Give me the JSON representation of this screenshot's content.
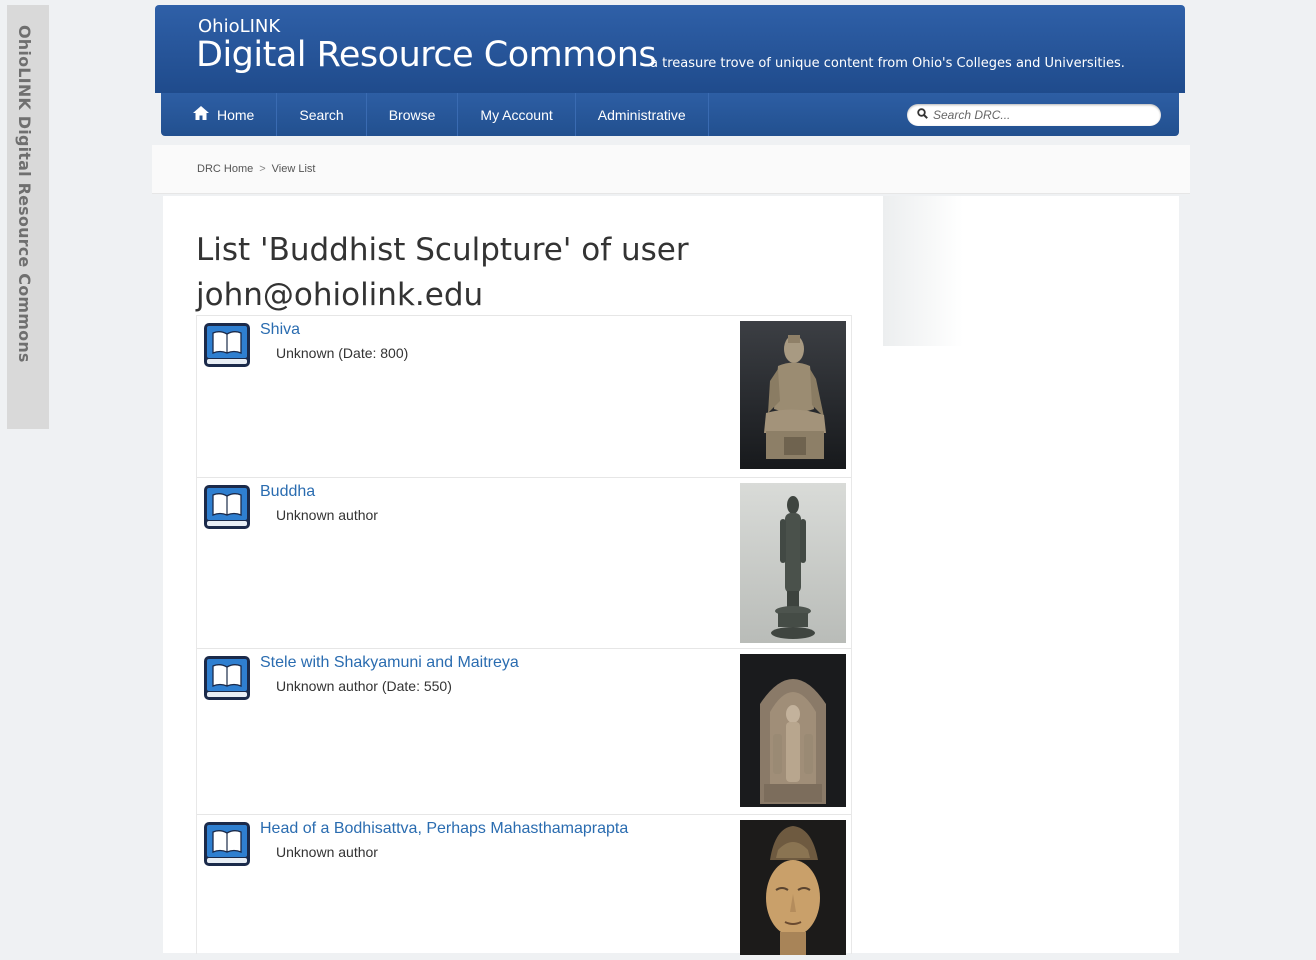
{
  "side_tab": "OhioLINK Digital Resource Commons",
  "header": {
    "brand_small": "OhioLINK",
    "brand_big": "Digital Resource Commons",
    "tagline": "a treasure trove of unique content from Ohio's Colleges and Universities."
  },
  "nav": {
    "items": [
      {
        "label": "Home",
        "icon": "home-icon"
      },
      {
        "label": "Search"
      },
      {
        "label": "Browse"
      },
      {
        "label": "My Account"
      },
      {
        "label": "Administrative"
      }
    ],
    "search_placeholder": "Search DRC..."
  },
  "breadcrumb": {
    "home": "DRC Home",
    "separator": ">",
    "current": "View List"
  },
  "page_title": "List 'Buddhist Sculpture' of user john@ohiolink.edu",
  "items": [
    {
      "title": "Shiva",
      "meta": "Unknown (Date: 800)",
      "icon": "book-icon"
    },
    {
      "title": "Buddha",
      "meta": "Unknown author",
      "icon": "book-icon"
    },
    {
      "title": "Stele with Shakyamuni and Maitreya",
      "meta": "Unknown author (Date: 550)",
      "icon": "book-icon"
    },
    {
      "title": "Head of a Bodhisattva, Perhaps Mahasthamaprapta",
      "meta": "Unknown author",
      "icon": "book-icon"
    }
  ],
  "colors": {
    "header_blue": "#2a5a9e",
    "link_blue": "#2a6cb0"
  }
}
